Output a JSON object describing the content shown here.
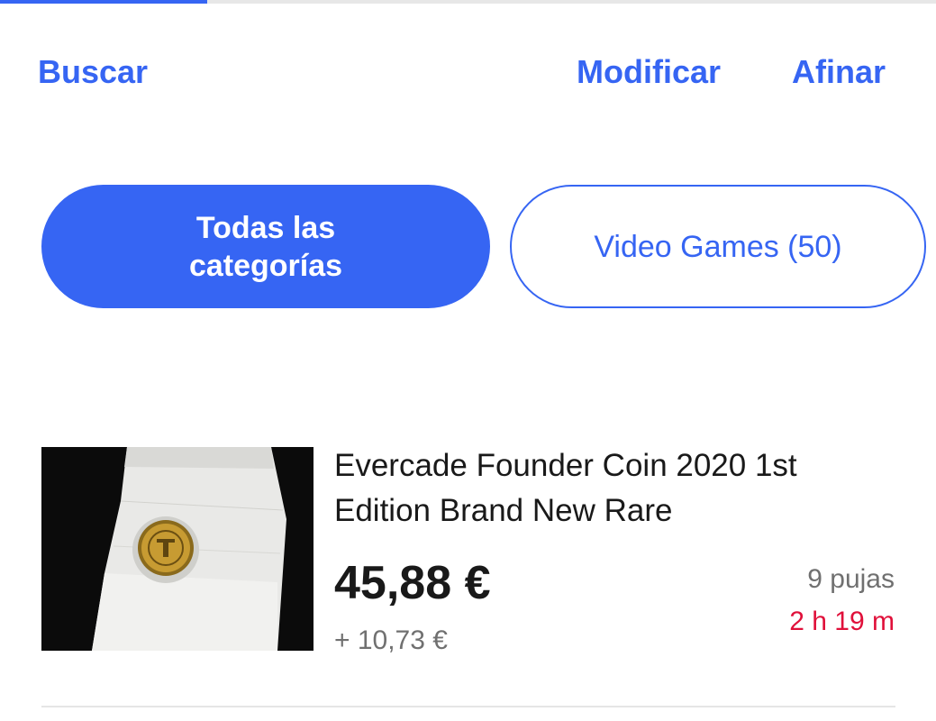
{
  "toolbar": {
    "search_label": "Buscar",
    "modify_label": "Modificar",
    "refine_label": "Afinar"
  },
  "category_filters": [
    {
      "label": "Todas las categorías",
      "selected": true
    },
    {
      "label": "Video Games (50)",
      "selected": false
    }
  ],
  "listing": {
    "title": "Evercade Founder Coin 2020 1st Edition Brand New Rare",
    "price": "45,88 €",
    "shipping": "+ 10,73 €",
    "bids": "9 pujas",
    "time_left": "2 h 19 m"
  },
  "colors": {
    "accent": "#3665f3",
    "text_primary": "#191919",
    "text_secondary": "#707070",
    "urgent": "#e0103a"
  }
}
